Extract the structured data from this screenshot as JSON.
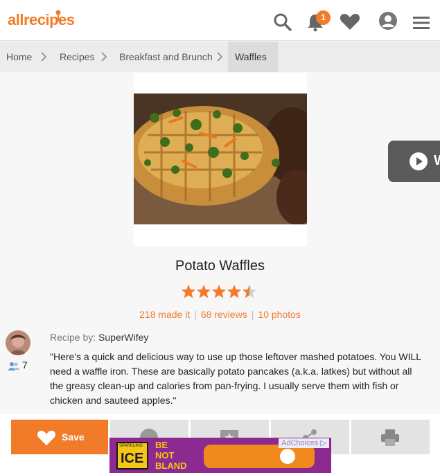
{
  "header": {
    "logo_text": "allrecipes",
    "notification_count": "1",
    "icons": [
      "search-icon",
      "bell-icon",
      "heart-icon",
      "profile-icon",
      "menu-icon"
    ]
  },
  "breadcrumb": {
    "items": [
      "Home",
      "Recipes",
      "Breakfast and Brunch",
      "Waffles"
    ]
  },
  "video_button": {
    "label": "W"
  },
  "recipe": {
    "title": "Potato Waffles",
    "rating": 4.5,
    "rating_max": 5,
    "made_it": "218 made it",
    "reviews": "68 reviews",
    "photos": "10 photos",
    "byline_prefix": "Recipe by:",
    "author": "SuperWifey",
    "followers": "7",
    "description": "\"Here's a quick and delicious way to use up those leftover mashed potatoes. You WILL need a waffle iron. These are basically potato pancakes (a.k.a. latkes) but without all the greasy clean-up and calories from pan-frying. I usually serve them with fish or chicken and sauteed apples.\""
  },
  "actions": {
    "save_label": "Save"
  },
  "ad": {
    "adchoices_label": "AdChoices",
    "brand_top": "SPARKLING",
    "brand": "ICE",
    "slogan_1": "BE",
    "slogan_2": "NOT",
    "slogan_3": "BLAND"
  },
  "colors": {
    "accent": "#f27b2a",
    "header_bg": "#ffffff",
    "breadcrumb_bg": "#ececec",
    "ad_bg": "#8d2a8f"
  }
}
